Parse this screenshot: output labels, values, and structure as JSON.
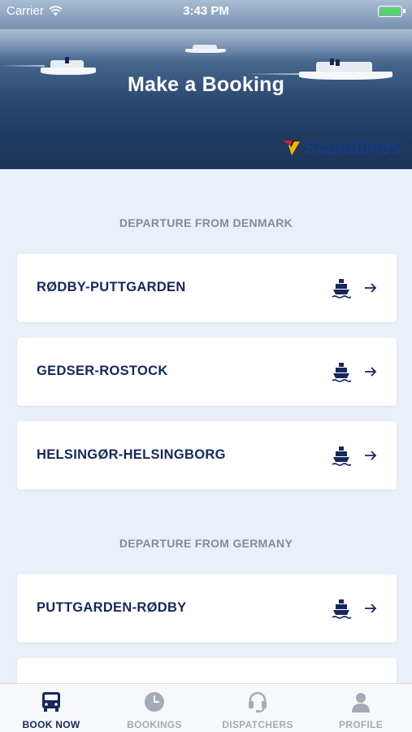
{
  "status_bar": {
    "carrier": "Carrier",
    "time": "3:43 PM",
    "battery_color": "#4cd964"
  },
  "header": {
    "title": "Make a Booking",
    "brand": "Scandlines",
    "brand_color": "#163e86"
  },
  "sections": [
    {
      "title": "DEPARTURE FROM DENMARK",
      "routes": [
        {
          "name": "RØDBY-PUTTGARDEN",
          "icon": "ferry-icon",
          "action_icon": "arrow-right-icon"
        },
        {
          "name": "GEDSER-ROSTOCK",
          "icon": "ferry-icon",
          "action_icon": "arrow-right-icon"
        },
        {
          "name": "HELSINGØR-HELSINGBORG",
          "icon": "ferry-icon",
          "action_icon": "arrow-right-icon"
        }
      ]
    },
    {
      "title": "DEPARTURE FROM GERMANY",
      "routes": [
        {
          "name": "PUTTGARDEN-RØDBY",
          "icon": "ferry-icon",
          "action_icon": "arrow-right-icon"
        }
      ]
    }
  ],
  "tabbar": {
    "tabs": [
      {
        "label": "BOOK NOW",
        "icon": "truck-icon",
        "active": true
      },
      {
        "label": "BOOKINGS",
        "icon": "clock-icon",
        "active": false
      },
      {
        "label": "DISPATCHERS",
        "icon": "headset-icon",
        "active": false
      },
      {
        "label": "PROFILE",
        "icon": "user-icon",
        "active": false
      }
    ]
  },
  "colors": {
    "accent": "#16285a",
    "background": "#e9f0f9",
    "section_title": "#7d8ca3",
    "tab_inactive": "#a3abb7"
  }
}
